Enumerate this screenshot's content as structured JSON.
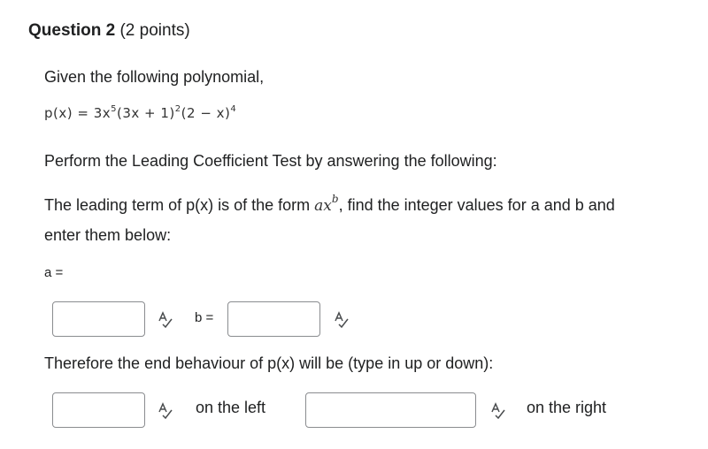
{
  "question": {
    "title_bold": "Question 2",
    "title_points": "(2 points)"
  },
  "intro": "Given the following polynomial,",
  "polynomial": {
    "lhs": "p(x) = 3x",
    "e1": "5",
    "mid1": "(3x + 1)",
    "e2": "2",
    "mid2": "(2 − x)",
    "e3": "4"
  },
  "instruction": "Perform the Leading Coefficient Test by answering the following:",
  "leading_term": {
    "before": "The leading term of p(x) is of the form",
    "form_base": "ax",
    "form_exp": "b",
    "after": ", find the integer values for a and b and",
    "line2": "enter them below:"
  },
  "fields": {
    "a_label": "a =",
    "b_label": "b =",
    "a_value": "",
    "b_value": "",
    "left_value": "",
    "right_value": ""
  },
  "end_behaviour_prompt": "Therefore the end behaviour of p(x) will be (type in up or down):",
  "labels": {
    "on_left": "on the left",
    "on_right": "on the right"
  },
  "icons": {
    "spellcheck": "spellcheck-icon"
  }
}
